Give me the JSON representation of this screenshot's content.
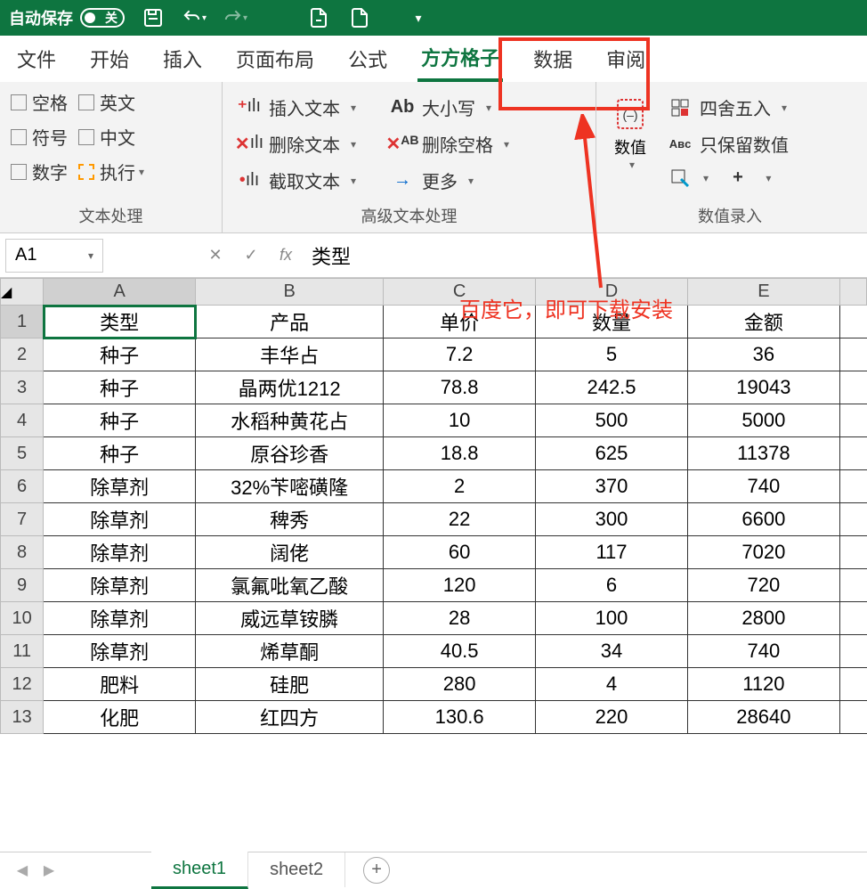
{
  "titlebar": {
    "autosave": "自动保存",
    "toggle": "关"
  },
  "tabs": [
    "文件",
    "开始",
    "插入",
    "页面布局",
    "公式",
    "方方格子",
    "数据",
    "审阅"
  ],
  "active_tab_index": 5,
  "ribbon": {
    "group1": {
      "label": "文本处理",
      "items": [
        "空格",
        "英文",
        "符号",
        "中文",
        "数字",
        "执行"
      ]
    },
    "group2": {
      "label": "高级文本处理",
      "col1": [
        "插入文本",
        "删除文本",
        "截取文本"
      ],
      "col2": [
        "大小写",
        "删除空格",
        "更多"
      ]
    },
    "group3": {
      "numeric": "数值",
      "label": "数值录入",
      "items": [
        "四舍五入",
        "只保留数值"
      ]
    }
  },
  "annotation": "百度它，即可下载安装",
  "namebox": "A1",
  "formula": "类型",
  "columns": [
    "A",
    "B",
    "C",
    "D",
    "E"
  ],
  "headers": [
    "类型",
    "产品",
    "单价",
    "数量",
    "金额"
  ],
  "rows": [
    {
      "n": 1,
      "c": [
        "类型",
        "产品",
        "单价",
        "数量",
        "金额"
      ]
    },
    {
      "n": 2,
      "c": [
        "种子",
        "丰华占",
        "7.2",
        "5",
        "36"
      ]
    },
    {
      "n": 3,
      "c": [
        "种子",
        "晶两优1212",
        "78.8",
        "242.5",
        "19043"
      ]
    },
    {
      "n": 4,
      "c": [
        "种子",
        "水稻种黄花占",
        "10",
        "500",
        "5000"
      ]
    },
    {
      "n": 5,
      "c": [
        "种子",
        "原谷珍香",
        "18.8",
        "625",
        "11378"
      ]
    },
    {
      "n": 6,
      "c": [
        "除草剂",
        "32%苄嘧磺隆",
        "2",
        "370",
        "740"
      ]
    },
    {
      "n": 7,
      "c": [
        "除草剂",
        "稗秀",
        "22",
        "300",
        "6600"
      ]
    },
    {
      "n": 8,
      "c": [
        "除草剂",
        "阔佬",
        "60",
        "117",
        "7020"
      ]
    },
    {
      "n": 9,
      "c": [
        "除草剂",
        "氯氟吡氧乙酸",
        "120",
        "6",
        "720"
      ]
    },
    {
      "n": 10,
      "c": [
        "除草剂",
        "威远草铵膦",
        "28",
        "100",
        "2800"
      ]
    },
    {
      "n": 11,
      "c": [
        "除草剂",
        "烯草酮",
        "40.5",
        "34",
        "740"
      ]
    },
    {
      "n": 12,
      "c": [
        "肥料",
        "硅肥",
        "280",
        "4",
        "1120"
      ]
    },
    {
      "n": 13,
      "c": [
        "化肥",
        "红四方",
        "130.6",
        "220",
        "28640"
      ]
    }
  ],
  "sheets": [
    "sheet1",
    "sheet2"
  ],
  "active_sheet": 0
}
